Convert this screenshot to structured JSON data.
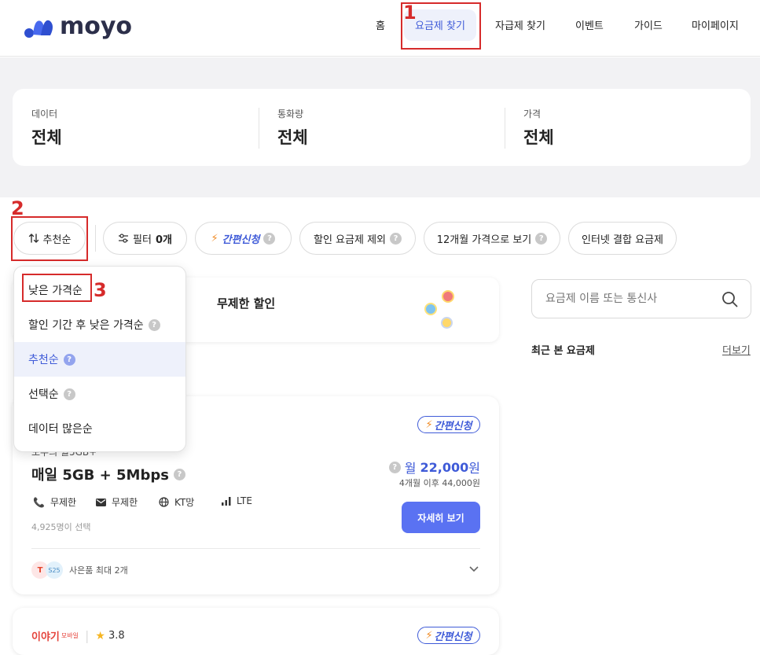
{
  "header": {
    "logo_text": "moyo",
    "nav": [
      "홈",
      "요금제 찾기",
      "자급제 찾기",
      "이벤트",
      "가이드",
      "마이페이지"
    ],
    "active_nav": "요금제 찾기"
  },
  "filters": {
    "data": {
      "label": "데이터",
      "value": "전체"
    },
    "talk": {
      "label": "통화량",
      "value": "전체"
    },
    "price": {
      "label": "가격",
      "value": "전체"
    }
  },
  "chips": {
    "sort": "추천순",
    "filter_label": "필터",
    "filter_count": "0개",
    "easy_apply": "간편신청",
    "exclude_discount": "할인 요금제 제외",
    "twelve_month": "12개월 가격으로 보기",
    "internet_bundle": "인터넷 결합 요금제"
  },
  "banner": {
    "text": "무제한 할인"
  },
  "sort_menu": {
    "items": [
      "낮은 가격순",
      "할인 기간 후 낮은 가격순",
      "추천순",
      "선택순",
      "데이터 많은순"
    ],
    "selected": "추천순"
  },
  "plan": {
    "badge": "간편신청",
    "partial_title": "모두의 월5GB+",
    "name": "매일 5GB + 5Mbps",
    "voice": "무제한",
    "sms": "무제한",
    "network": "KT망",
    "type": "LTE",
    "chosen": "4,925명이 선택",
    "price_prefix": "월",
    "price": "22,000",
    "price_unit": "원",
    "after_price": "4개월 이후 44,000원",
    "detail_button": "자세히 보기",
    "gift": "사은품 최대 2개",
    "gift_badge_1": "T",
    "gift_badge_2": "S25"
  },
  "plan2": {
    "carrier": "이야기",
    "carrier_suffix": "모바일",
    "rating": "3.8",
    "badge": "간편신청"
  },
  "sidebar": {
    "search_placeholder": "요금제 이름 또는 통신사",
    "recent_title": "최근 본 요금제",
    "more_link": "더보기"
  },
  "annotations": [
    "1",
    "2",
    "3"
  ],
  "colors": {
    "accent": "#3f5bd8",
    "button": "#5a72f2",
    "annotation": "#d62b2b"
  }
}
